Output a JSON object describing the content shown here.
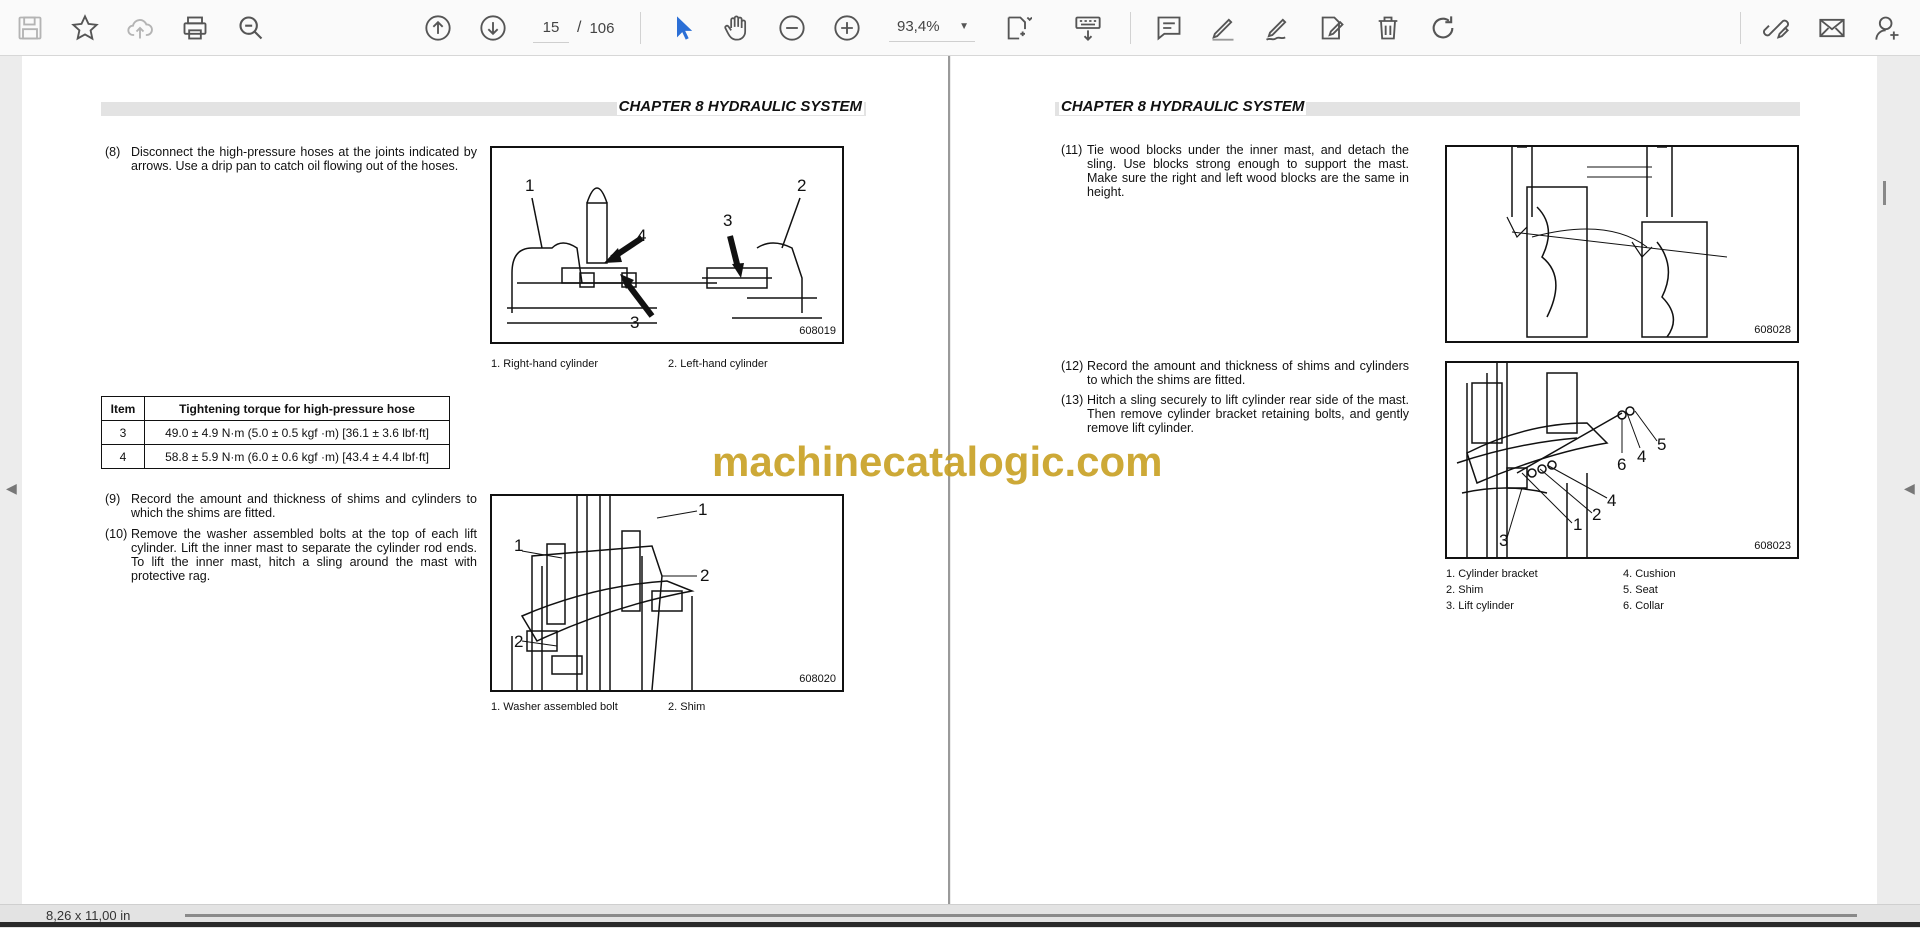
{
  "toolbar": {
    "icons": [
      "save-icon",
      "bookmark-star-icon",
      "cloud-upload-icon",
      "print-icon",
      "zoom-search-icon",
      "prev-page-icon",
      "next-page-icon",
      "select-cursor-icon",
      "hand-pan-icon",
      "zoom-out-icon",
      "zoom-in-icon",
      "page-fit-icon",
      "keyboard-icon",
      "comment-icon",
      "highlight-pen-icon",
      "draw-sign-icon",
      "edit-text-icon",
      "delete-icon",
      "rotate-icon",
      "link-tools-icon",
      "email-icon",
      "add-user-icon"
    ],
    "current_page": "15",
    "page_sep": "/",
    "total_pages": "106",
    "zoom": "93,4%"
  },
  "left_page": {
    "chapter": "CHAPTER 8 HYDRAULIC SYSTEM",
    "step8_num": "(8)",
    "step8_text": "Disconnect the high-pressure hoses at the joints indicated by arrows. Use a drip pan to catch oil flowing out of the hoses.",
    "fig1_code": "608019",
    "fig1_cap1": "1. Right-hand cylinder",
    "fig1_cap2": "2. Left-hand cylinder",
    "fig1_labels": [
      "1",
      "2",
      "3",
      "4",
      "3"
    ],
    "table": {
      "headers": [
        "Item",
        "Tightening torque for high-pressure hose"
      ],
      "rows": [
        {
          "item": "3",
          "value": "49.0 ± 4.9 N·m (5.0 ± 0.5 kgf ·m) [36.1 ± 3.6 lbf·ft]"
        },
        {
          "item": "4",
          "value": "58.8 ± 5.9 N·m (6.0 ± 0.6 kgf ·m) [43.4 ± 4.4 lbf·ft]"
        }
      ]
    },
    "step9_num": "(9)",
    "step9_text": "Record the amount and thickness of shims and cylinders to which the shims are fitted.",
    "step10_num": "(10)",
    "step10_text": "Remove the washer assembled bolts at the top of each lift cylinder. Lift the inner mast to separate the cylinder rod ends. To lift the inner mast, hitch a sling around the mast with protective rag.",
    "fig2_code": "608020",
    "fig2_cap1": "1. Washer assembled bolt",
    "fig2_cap2": "2. Shim",
    "fig2_labels": [
      "1",
      "1",
      "2",
      "2"
    ]
  },
  "right_page": {
    "chapter": "CHAPTER 8 HYDRAULIC SYSTEM",
    "step11_num": "(11)",
    "step11_text": "Tie wood blocks under the inner mast, and detach the sling. Use blocks strong enough to support the mast. Make sure the right and left wood blocks are the same in height.",
    "fig3_code": "608028",
    "step12_num": "(12)",
    "step12_text": "Record the amount and thickness of shims and cylinders to which the shims are fitted.",
    "step13_num": "(13)",
    "step13_text": "Hitch a sling securely to lift cylinder rear side of the mast. Then remove cylinder bracket retaining bolts, and gently remove lift cylinder.",
    "fig4_code": "608023",
    "fig4_labels": [
      "5",
      "4",
      "6",
      "4",
      "2",
      "1",
      "3"
    ],
    "fig4_caps": [
      "1. Cylinder bracket",
      "2. Shim",
      "3. Lift cylinder",
      "4. Cushion",
      "5. Seat",
      "6. Collar"
    ]
  },
  "watermark": "machinecatalogic.com",
  "status": {
    "page_size": "8,26 x 11,00 in"
  },
  "colors": {
    "toolbar_bg": "#fafafa",
    "accent_cursor": "#2b6fd6",
    "watermark": "#c9a227"
  }
}
